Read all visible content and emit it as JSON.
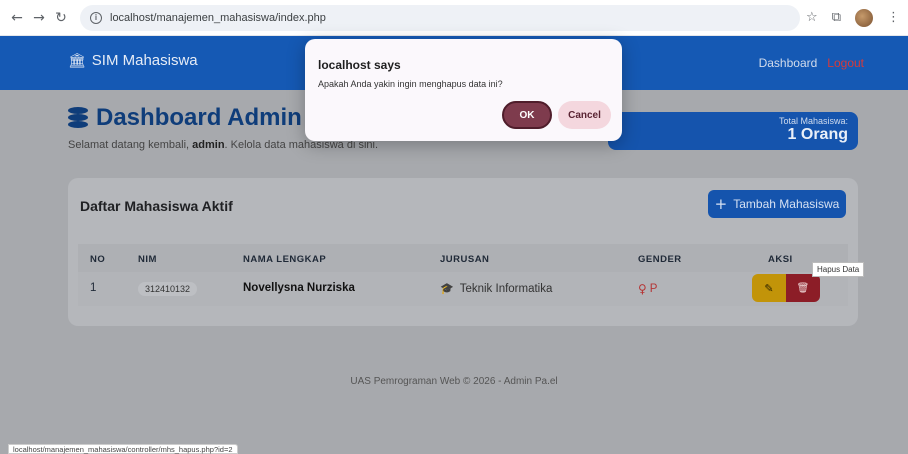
{
  "browser": {
    "url": "localhost/manajemen_mahasiswa/index.php",
    "status_url": "localhost/manajemen_mahasiswa/controller/mhs_hapus.php?id=2"
  },
  "navbar": {
    "brand": "SIM Mahasiswa",
    "dashboard": "Dashboard",
    "logout": "Logout"
  },
  "header": {
    "title": "Dashboard Admin",
    "welcome_prefix": "Selamat datang kembali, ",
    "welcome_user": "admin",
    "welcome_suffix": ". Kelola data mahasiswa di sini."
  },
  "total": {
    "label": "Total Mahasiswa:",
    "value": "1 Orang"
  },
  "table": {
    "title": "Daftar Mahasiswa Aktif",
    "add_button": "Tambah Mahasiswa",
    "columns": [
      "NO",
      "NIM",
      "NAMA LENGKAP",
      "JURUSAN",
      "GENDER",
      "AKSI"
    ],
    "rows": [
      {
        "no": "1",
        "nim": "312410132",
        "nama": "Novellysna Nurziska",
        "jurusan": "Teknik Informatika",
        "gender": "P"
      }
    ]
  },
  "tooltip": "Hapus Data",
  "footer": "UAS Pemrograman Web © 2026 - Admin Pa.el",
  "dialog": {
    "title": "localhost says",
    "message": "Apakah Anda yakin ingin menghapus data ini?",
    "ok": "OK",
    "cancel": "Cancel"
  },
  "colors": {
    "navbar": "#1559b4",
    "primary": "#1554ad",
    "edit": "#c29409",
    "delete": "#8c1d27",
    "dialog_ok": "#7e3b4d",
    "dialog_cancel": "#f4d7de"
  }
}
